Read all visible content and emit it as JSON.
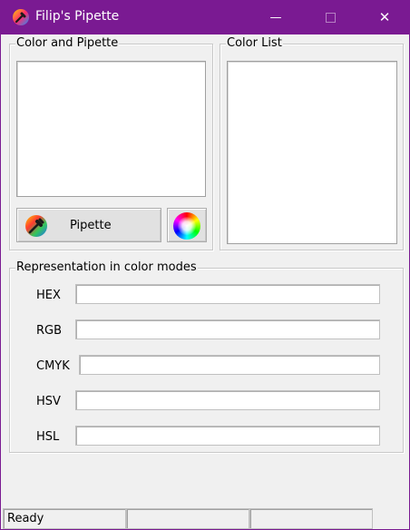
{
  "window": {
    "title": "Filip's Pipette",
    "minimize_glyph": "—",
    "close_glyph": "✕",
    "icon": "color-pipette-app-icon"
  },
  "color_and_pipette": {
    "label": "Color and Pipette",
    "pipette_button_label": "Pipette",
    "pipette_icon": "pipette-icon",
    "color_wheel_icon": "color-wheel-icon"
  },
  "color_list": {
    "label": "Color List",
    "items": []
  },
  "representation": {
    "label": "Representation in color modes",
    "modes": [
      {
        "label": "HEX",
        "value": ""
      },
      {
        "label": "RGB",
        "value": ""
      },
      {
        "label": "CMYK",
        "value": ""
      },
      {
        "label": "HSV",
        "value": ""
      },
      {
        "label": "HSL",
        "value": ""
      }
    ]
  },
  "statusbar": {
    "status": "Ready",
    "pane2": "",
    "pane3": ""
  },
  "colors": {
    "titlebar": "#7a1a92",
    "window_bg": "#f0f0f0"
  }
}
